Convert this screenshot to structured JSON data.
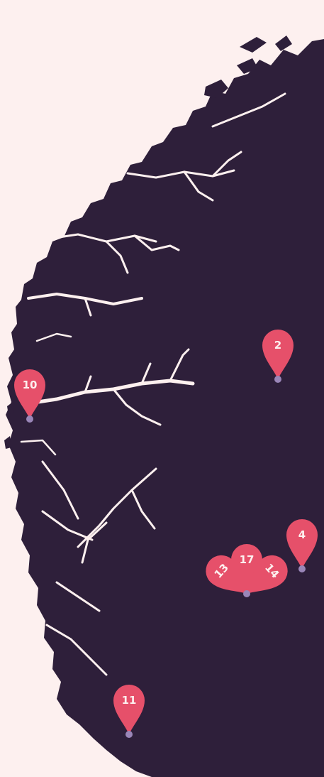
{
  "colors": {
    "background": "#fdf0ef",
    "land": "#2e1f3a",
    "pin": "#e6506a",
    "pin_text": "#fdf0ef",
    "pin_anchor": "#9a86b8"
  },
  "markers": [
    {
      "label": "2"
    },
    {
      "label": "10"
    },
    {
      "label": "4"
    },
    {
      "label": "13"
    },
    {
      "label": "17"
    },
    {
      "label": "14"
    },
    {
      "label": "11"
    }
  ]
}
